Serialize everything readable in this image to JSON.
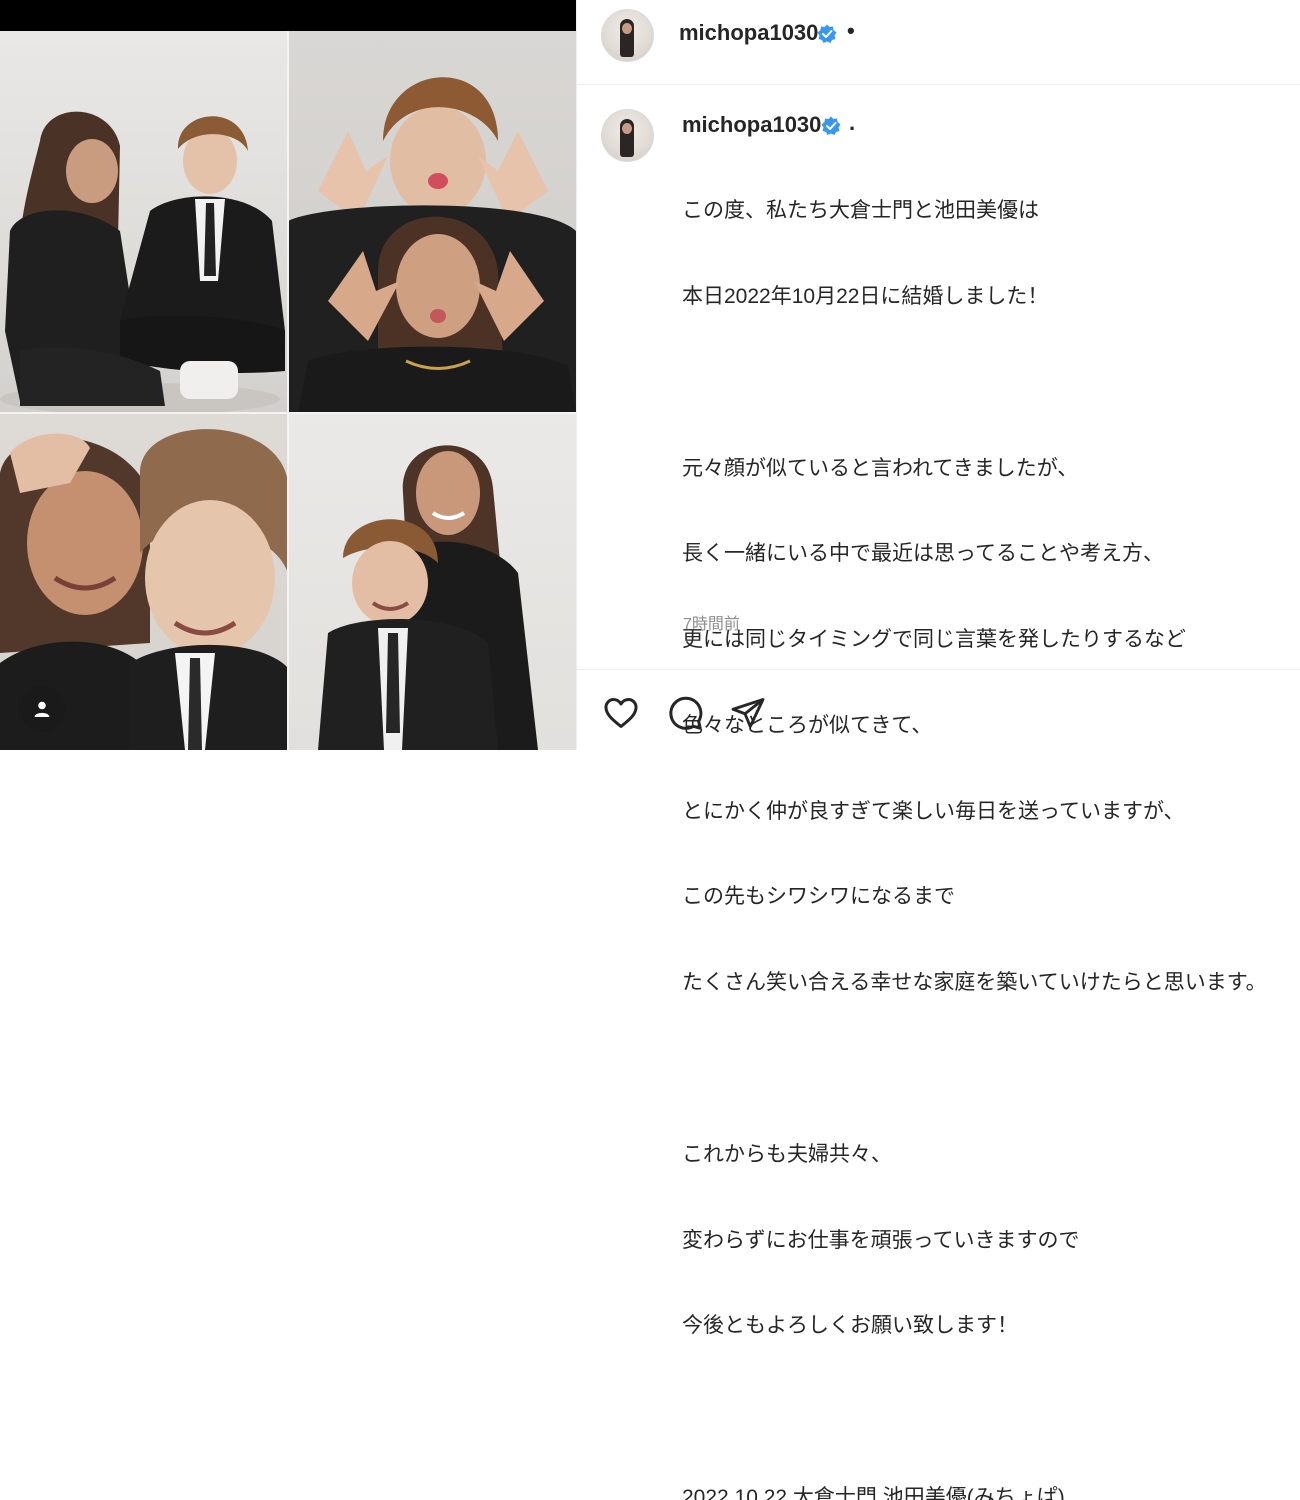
{
  "post": {
    "header_username": "michopa1030",
    "caption_username": "michopa1030",
    "caption_lines": [
      "この度、私たち大倉士門と池田美優は",
      "本日2022年10月22日に結婚しました！",
      "",
      "元々顔が似ていると言われてきましたが、",
      "長く一緒にいる中で最近は思ってることや考え方、",
      "更には同じタイミングで同じ言葉を発したりするなど",
      "色々なところが似てきて、",
      "とにかく仲が良すぎて楽しい毎日を送っていますが、",
      "この先もシワシワになるまで",
      "たくさん笑い合える幸せな家庭を築いていけたらと思います。",
      "",
      "これからも夫婦共々、",
      "変わらずにお仕事を頑張っていきますので",
      "今後ともよろしくお願い致します！",
      "",
      "2022.10.22 大倉士門 池田美優(みちょぱ)"
    ],
    "timestamp": "7時間前",
    "header_separator": "•",
    "caption_separator": "."
  },
  "icons": {
    "verified": "verified-badge-icon",
    "like": "heart-icon",
    "comment": "comment-bubble-icon",
    "share": "paper-plane-icon",
    "user_tag": "person-icon"
  },
  "colors": {
    "verified_blue": "#3897f0",
    "text": "#262626",
    "secondary_text": "#8e8e8e",
    "divider": "#efefef"
  }
}
